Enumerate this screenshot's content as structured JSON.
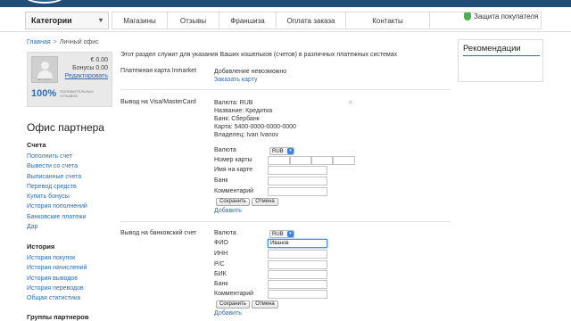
{
  "nav": {
    "categories": "Категории",
    "items": [
      "Магазины",
      "Отзывы",
      "Франшиза",
      "Оплата заказа",
      "Контакты"
    ],
    "protection": "Защита покупателя"
  },
  "breadcrumb": {
    "home": "Главная",
    "current": "Личный офис"
  },
  "profile": {
    "avatar_caption": "НЕТ ФОТО",
    "balance": "€ 0.00",
    "bonus": "Бонусы 0.00",
    "edit": "Редактировать",
    "rating_pct": "100%",
    "rating_label_1": "ПОЛОЖИТЕЛЬНЫХ",
    "rating_label_2": "ОТЗЫВОВ"
  },
  "sidebar": {
    "title": "Офис партнера",
    "groups": [
      {
        "heading": "Счета",
        "links": [
          "Пополнить счет",
          "Вывести со счета",
          "Выписанные счета",
          "Перевод средств",
          "Купить бонусы",
          "История пополнений",
          "Банковские платежи",
          "Дар"
        ]
      },
      {
        "heading": "История",
        "links": [
          "История покупок",
          "История начислений",
          "История выводов",
          "История переводов",
          "Общая статистика"
        ]
      },
      {
        "heading": "Группы партнеров",
        "links": []
      }
    ]
  },
  "main": {
    "intro": "Этот раздел служит для указания Ваших кошельков (счетов) в различных платежных системах",
    "inmarket": {
      "label": "Платежная карта Inmarket",
      "status": "Добавление невозможно",
      "order": "Заказать карту"
    },
    "visa": {
      "label": "Вывод на Visa/MasterCard",
      "lines": [
        "Валюта: RUB",
        "Название: Кредитка",
        "Банк: Сбербанк",
        "Карта: 5400-0000-0000-0000",
        "Владелец: Ivan Ivanov"
      ],
      "currency_label": "Валюта",
      "currency_value": "RUB",
      "card_label": "Номер карты",
      "name_label": "Имя на карте",
      "bank_label": "Банк",
      "comment_label": "Комментарий",
      "save": "Сохранить",
      "cancel": "Отмена",
      "add": "Добавить"
    },
    "bank": {
      "label": "Вывод на банковский счет",
      "currency_label": "Валюта",
      "currency_value": "RUB",
      "fio_label": "ФИО",
      "fio_value": "Иванов",
      "inn_label": "ИНН",
      "rs_label": "Р/С",
      "bik_label": "БИК",
      "bank_label": "Банк",
      "comment_label": "Комментарий",
      "save": "Сохранить",
      "cancel": "Отмена",
      "add": "Добавить"
    }
  },
  "reco": {
    "title": "Рекомендации"
  },
  "colors": {
    "accent": "#2a6db5",
    "topbar": "#1f4e79",
    "shield": "#4caf50"
  }
}
